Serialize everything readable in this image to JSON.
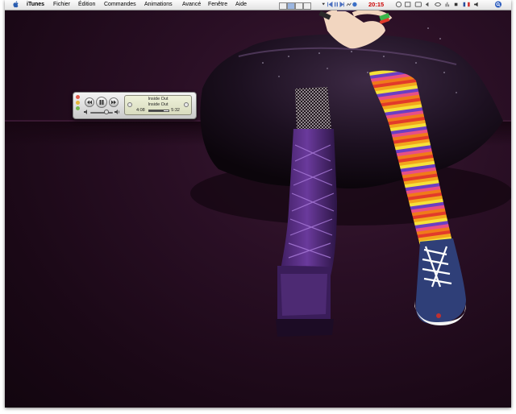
{
  "menubar": {
    "app_name": "iTunes",
    "menus": [
      "Fichier",
      "Édition",
      "Commandes",
      "Animations",
      "Avancé",
      "Fenêtre",
      "Aide"
    ],
    "clock": "20:15"
  },
  "mini_player": {
    "title": "Inside Out",
    "artist": "Inside Out",
    "elapsed": "4:08",
    "total": "5:32",
    "progress": 0.75,
    "volume": 0.7
  },
  "icons": {
    "apple": "apple-icon",
    "prev": "previous-track-icon",
    "pause": "pause-icon",
    "next": "next-track-icon",
    "volume_low": "speaker-low-icon",
    "volume_high": "speaker-high-icon",
    "spotlight": "spotlight-icon"
  },
  "colors": {
    "desktop": "#2a0f25",
    "clock": "#cc0000",
    "lcd": "#e4e7cc"
  }
}
